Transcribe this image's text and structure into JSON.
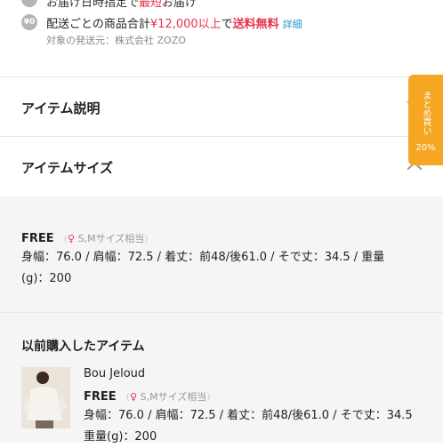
{
  "banner": {
    "cut_prefix": "お届け日時指定で",
    "cut_highlight": "最短",
    "cut_suffix": "お届け",
    "yen_icon": "¥0",
    "ship_prefix": "配送ごとの商品合計",
    "ship_amount": "¥12,000以上",
    "ship_mid": "で",
    "ship_free": "送料無料",
    "ship_link": "詳細",
    "origin": "対象の発送元：株式会社 ZOZO"
  },
  "sections": {
    "description": "アイテム説明",
    "size": "アイテムサイズ"
  },
  "size_info": {
    "name": "FREE",
    "hint": "S,Mサイズ相当",
    "measurements_line1": "身幅：76.0 / 肩幅：72.5 / 着丈：前48/後61.0 / そで丈：34.5 / 重量",
    "measurements_line2": "(g)：200"
  },
  "previous": {
    "title": "以前購入したアイテム",
    "brand": "Bou Jeloud",
    "size_name": "FREE",
    "hint": "S,Mサイズ相当",
    "measurements_line1": "身幅：76.0 / 肩幅：72.5 / 着丈：前48/後61.0 / そで丈：34.5",
    "measurements_line2": "重量(g)：200"
  },
  "side_badge": {
    "line1": "まとめ買い",
    "line2": "20%"
  },
  "colors": {
    "accent_red": "#e8334a",
    "badge_orange": "#f5a623",
    "link_blue": "#2b8fd6"
  }
}
